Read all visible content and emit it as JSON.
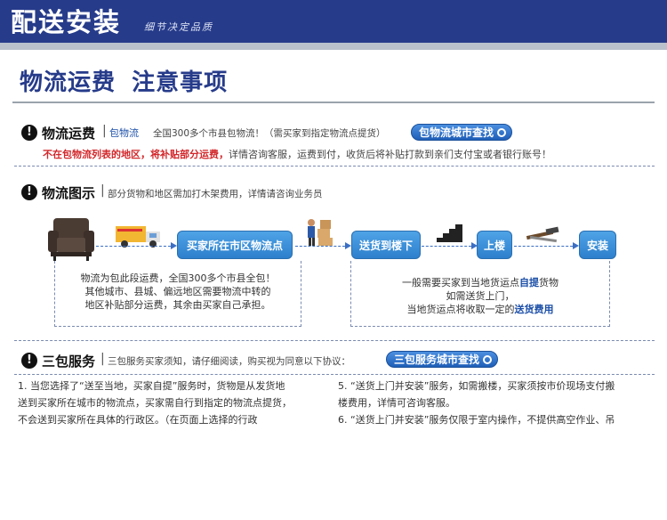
{
  "banner": {
    "title": "配送安装",
    "subtitle": "细节决定品质"
  },
  "section_title": "物流运费 注意事项",
  "section_title_parts": [
    "物流运费",
    "注意事项"
  ],
  "freight": {
    "heading": "物流运费",
    "tag": "包物流",
    "desc": "全国300多个市县包物流！（需买家到指定物流点提货）",
    "button": "包物流城市查找",
    "notice_red_1": "不在包物流列表的地区，",
    "notice_red_2": "将补贴部分运费，",
    "notice_rest": "详情咨询客服，运费到付，收货后将补贴打款到亲们支付宝或者银行账号！"
  },
  "diagram": {
    "heading": "物流图示",
    "desc": "部分货物和地区需加打木架费用，详情请咨询业务员",
    "step1": "买家所在市区物流点",
    "step2": "送货到楼下",
    "step3": "上楼",
    "step4": "安装",
    "left_note": [
      "物流为包此段运费，全国300多个市县全包！",
      "其他城市、县城、偏远地区需要物流中转的",
      "地区补贴部分运费，其余由买家自己承担。"
    ],
    "right_note_line1_a": "一般需要买家到当地货运点",
    "right_note_line1_b": "自提",
    "right_note_line1_c": "货物",
    "right_note_line2": "如需送货上门，",
    "right_note_line3_a": "当地货运点将收取一定的",
    "right_note_line3_b": "送货费用"
  },
  "warranty": {
    "heading": "三包服务",
    "desc": "三包服务买家须知，请仔细阅读，购买视为同意以下协议：",
    "button": "三包服务城市查找",
    "left_lines": [
      "1. 当您选择了“送至当地，买家自提”服务时，货物是从发货地",
      "送到买家所在城市的物流点，买家需自行到指定的物流点提货，",
      "不会送到买家所在具体的行政区。（在页面上选择的行政"
    ],
    "right_lines": [
      "5. “送货上门并安装”服务，如需搬楼，买家须按市价现场支付搬",
      "楼费用，详情可咨询客服。",
      "6. “送货上门并安装”服务仅限于室内操作，不提供高空作业、吊"
    ]
  },
  "colors": {
    "banner": "#263b8a",
    "accent_blue": "#1c4fa8",
    "alert_red": "#d2272b"
  }
}
